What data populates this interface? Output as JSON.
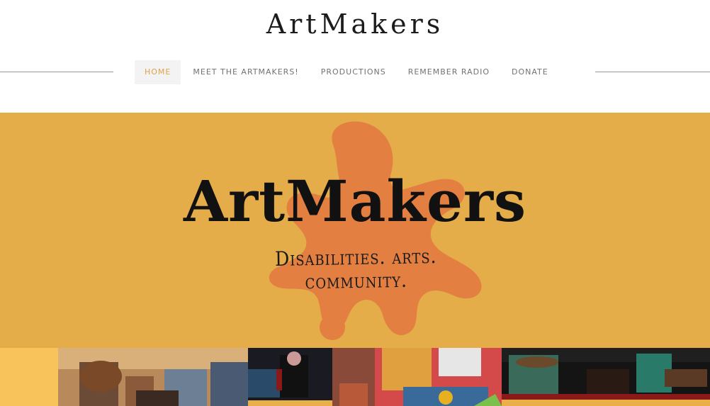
{
  "site": {
    "title": "ArtMakers"
  },
  "nav": {
    "items": [
      {
        "label": "HOME",
        "active": true
      },
      {
        "label": "MEET THE ARTMAKERS!",
        "active": false
      },
      {
        "label": "PRODUCTIONS",
        "active": false
      },
      {
        "label": "REMEMBER RADIO",
        "active": false
      },
      {
        "label": "DONATE",
        "active": false
      }
    ]
  },
  "hero": {
    "title": "ArtMakers",
    "tagline": "Disabilities. arts. community.",
    "background_color": "#e5ac4a",
    "splat_color": "#e37f40",
    "splat_icon": "paint-splat-icon"
  },
  "photo_strip": {
    "photos": [
      {
        "name": "photo-left-edge"
      },
      {
        "name": "photo-guitar-players"
      },
      {
        "name": "photo-performer-stage"
      },
      {
        "name": "photo-sitting-group"
      },
      {
        "name": "photo-stage-band"
      }
    ]
  },
  "colors": {
    "accent": "#e2a14a",
    "nav_text": "#727272"
  }
}
